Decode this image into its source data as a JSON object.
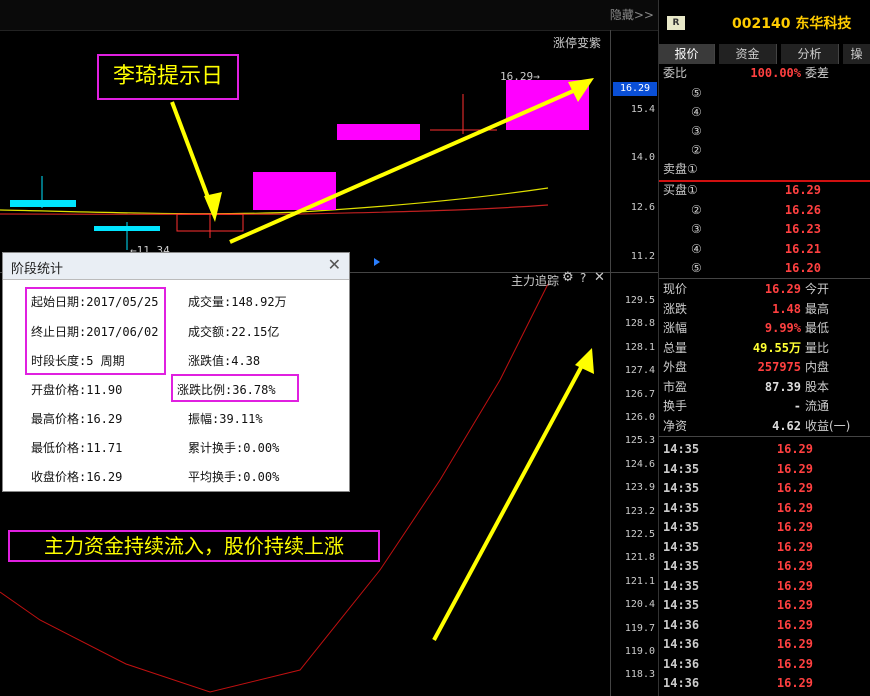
{
  "chart": {
    "hide_label": "隐藏>>",
    "limit_up_label": "涨停变紫",
    "price_label_1629": "16.29→",
    "low_label": "←11.34",
    "lower_panel_label": "主力追踪",
    "upper_axis": [
      "15.4",
      "14.0",
      "12.6",
      "11.2"
    ],
    "current_price_tag": "16.29",
    "lower_axis": [
      "129.5",
      "128.8",
      "128.1",
      "127.4",
      "126.7",
      "126.0",
      "125.3",
      "124.6",
      "123.9",
      "123.2",
      "122.5",
      "121.8",
      "121.1",
      "120.4",
      "119.7",
      "119.0",
      "118.3"
    ],
    "annotation_top": "李琦提示日",
    "annotation_bottom": "主力资金持续流入，股价持续上涨",
    "colors": {
      "up_candle": "#ff00ff",
      "down_candle": "#00e5ff",
      "arrow": "#ffff00",
      "highlight": "#e020e0",
      "ma_yellow": "#e0e000",
      "ma_red": "#c02020"
    }
  },
  "stats": {
    "title": "阶段统计",
    "start_date": "起始日期:2017/05/25",
    "end_date": "终止日期:2017/06/02",
    "period": "时段长度:5 周期",
    "open": "开盘价格:11.90",
    "high": "最高价格:16.29",
    "low": "最低价格:11.71",
    "close": "收盘价格:16.29",
    "volume": "成交量:148.92万",
    "amount": "成交额:22.15亿",
    "change": "涨跌值:4.38",
    "change_pct": "涨跌比例:36.78%",
    "amplitude": "振幅:39.11%",
    "turnover_total": "累计换手:0.00%",
    "turnover_avg": "平均换手:0.00%"
  },
  "quote": {
    "badge": "R",
    "code_name": "002140 东华科技",
    "tabs": [
      "报价",
      "资金",
      "分析",
      "操"
    ],
    "weibi_label": "委比",
    "weibi_value": "100.00%",
    "weicha_label": "委差",
    "sell_levels": [
      "⑤",
      "④",
      "③",
      "②"
    ],
    "sell1_label": "卖盘①",
    "buy_rows": [
      {
        "label": "买盘①",
        "price": "16.29"
      },
      {
        "label": "②",
        "price": "16.26"
      },
      {
        "label": "③",
        "price": "16.23"
      },
      {
        "label": "④",
        "price": "16.21"
      },
      {
        "label": "⑤",
        "price": "16.20"
      }
    ],
    "info_rows": [
      {
        "l1": "现价",
        "v": "16.29",
        "l2": "今开",
        "vc": "red"
      },
      {
        "l1": "涨跌",
        "v": "1.48",
        "l2": "最高",
        "vc": "red"
      },
      {
        "l1": "涨幅",
        "v": "9.99%",
        "l2": "最低",
        "vc": "red"
      },
      {
        "l1": "总量",
        "v": "49.55万",
        "l2": "量比",
        "vc": "yel"
      },
      {
        "l1": "外盘",
        "v": "257975",
        "l2": "内盘",
        "vc": "red"
      },
      {
        "l1": "市盈",
        "v": "87.39",
        "l2": "股本",
        "vc": "wht"
      },
      {
        "l1": "换手",
        "v": "-",
        "l2": "流通",
        "vc": "wht"
      },
      {
        "l1": "净资",
        "v": "4.62",
        "l2": "收益(一)",
        "vc": "wht"
      }
    ],
    "ticks": [
      {
        "time": "14:35",
        "price": "16.29"
      },
      {
        "time": "14:35",
        "price": "16.29"
      },
      {
        "time": "14:35",
        "price": "16.29"
      },
      {
        "time": "14:35",
        "price": "16.29"
      },
      {
        "time": "14:35",
        "price": "16.29"
      },
      {
        "time": "14:35",
        "price": "16.29"
      },
      {
        "time": "14:35",
        "price": "16.29"
      },
      {
        "time": "14:35",
        "price": "16.29"
      },
      {
        "time": "14:35",
        "price": "16.29"
      },
      {
        "time": "14:36",
        "price": "16.29"
      },
      {
        "time": "14:36",
        "price": "16.29"
      },
      {
        "time": "14:36",
        "price": "16.29"
      },
      {
        "time": "14:36",
        "price": "16.29"
      }
    ]
  }
}
